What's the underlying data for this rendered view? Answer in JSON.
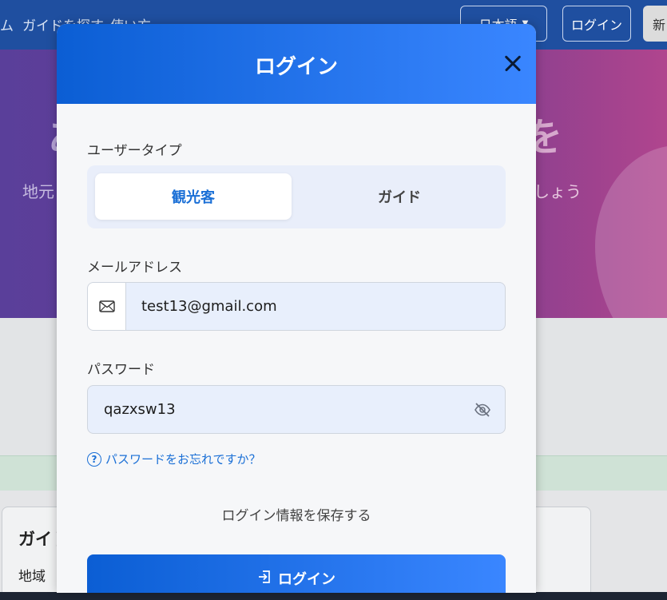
{
  "background": {
    "nav": {
      "brand_fragment": "ム",
      "links": [
        "ガイドを探す",
        "使い方"
      ],
      "language_label": "日本語",
      "login_label": "ログイン",
      "signup_label": "新"
    },
    "hero": {
      "big_left": "あ",
      "big_right": "を",
      "subtitle_left": "地元",
      "subtitle_right": "しょう"
    },
    "card": {
      "title": "ガイド",
      "label": "地域"
    }
  },
  "modal": {
    "title": "ログイン",
    "user_type_label": "ユーザータイプ",
    "user_types": [
      {
        "label": "観光客",
        "active": true
      },
      {
        "label": "ガイド",
        "active": false
      }
    ],
    "email_label": "メールアドレス",
    "email_value": "test13@gmail.com",
    "password_label": "パスワード",
    "password_value": "qazxsw13",
    "forgot_label": "パスワードをお忘れですか？",
    "remember_label": "ログイン情報を保存する",
    "submit_label": "ログイン"
  },
  "colors": {
    "primary": "#1a6fd6",
    "header_gradient_start": "#0b5ed4",
    "header_gradient_end": "#3a86ff",
    "input_bg": "#e8effc"
  },
  "icons": {
    "close": "close-icon",
    "email": "envelope-icon",
    "password_toggle": "eye-slash-icon",
    "help": "question-circle-icon",
    "login": "sign-in-icon"
  }
}
